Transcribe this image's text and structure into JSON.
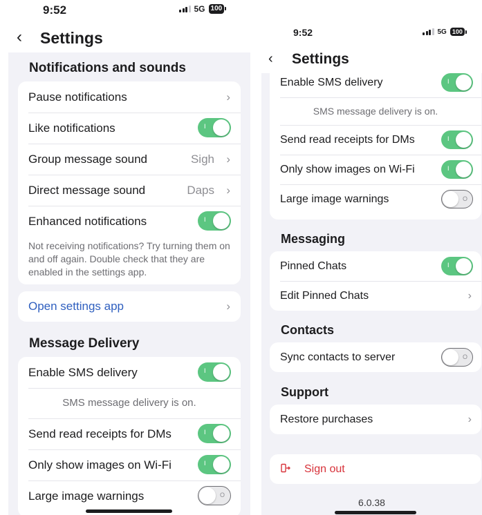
{
  "left": {
    "status": {
      "time": "9:52",
      "network": "5G",
      "battery": "100"
    },
    "nav": {
      "back": "‹",
      "title": "Settings"
    },
    "notifications": {
      "title": "Notifications and sounds",
      "rows": [
        {
          "label": "Pause notifications",
          "chevron": "›"
        },
        {
          "label": "Like notifications",
          "toggle": "on"
        },
        {
          "label": "Group message sound",
          "value": "Sigh",
          "chevron": "›"
        },
        {
          "label": "Direct message sound",
          "value": "Daps",
          "chevron": "›"
        },
        {
          "label": "Enhanced notifications",
          "toggle": "on"
        }
      ],
      "hint": "Not receiving notifications? Try turning them on and off again. Double check that they are enabled in the settings app.",
      "open_settings": "Open settings app",
      "chevron": "›"
    },
    "delivery": {
      "title": "Message Delivery",
      "rows": [
        {
          "label": "Enable SMS delivery",
          "toggle": "on"
        },
        {
          "label": "SMS message delivery is on."
        },
        {
          "label": "Send read receipts for DMs",
          "toggle": "on"
        },
        {
          "label": "Only show images on Wi-Fi",
          "toggle": "on"
        },
        {
          "label": "Large image warnings",
          "toggle": "off"
        }
      ]
    },
    "toggle_on_mark": "I",
    "toggle_off_mark": "O"
  },
  "right": {
    "status": {
      "time": "9:52",
      "network": "5G",
      "battery": "100"
    },
    "nav": {
      "back": "‹",
      "title": "Settings"
    },
    "delivery": {
      "rows": [
        {
          "label": "Enable SMS delivery",
          "toggle": "on"
        },
        {
          "label": "SMS message delivery is on."
        },
        {
          "label": "Send read receipts for DMs",
          "toggle": "on"
        },
        {
          "label": "Only show images on Wi-Fi",
          "toggle": "on"
        },
        {
          "label": "Large image warnings",
          "toggle": "off"
        }
      ]
    },
    "messaging": {
      "title": "Messaging",
      "rows": [
        {
          "label": "Pinned Chats",
          "toggle": "on"
        },
        {
          "label": "Edit Pinned Chats",
          "chevron": "›"
        }
      ]
    },
    "contacts": {
      "title": "Contacts",
      "rows": [
        {
          "label": "Sync contacts to server",
          "toggle": "off"
        }
      ]
    },
    "support": {
      "title": "Support",
      "rows": [
        {
          "label": "Restore purchases",
          "chevron": "›"
        }
      ]
    },
    "sign_out": "Sign out",
    "version": "6.0.38"
  },
  "colors": {
    "toggle_on": "#5cc681",
    "link": "#2f5fbf",
    "danger": "#d7323a",
    "background": "#f2f2f7"
  }
}
